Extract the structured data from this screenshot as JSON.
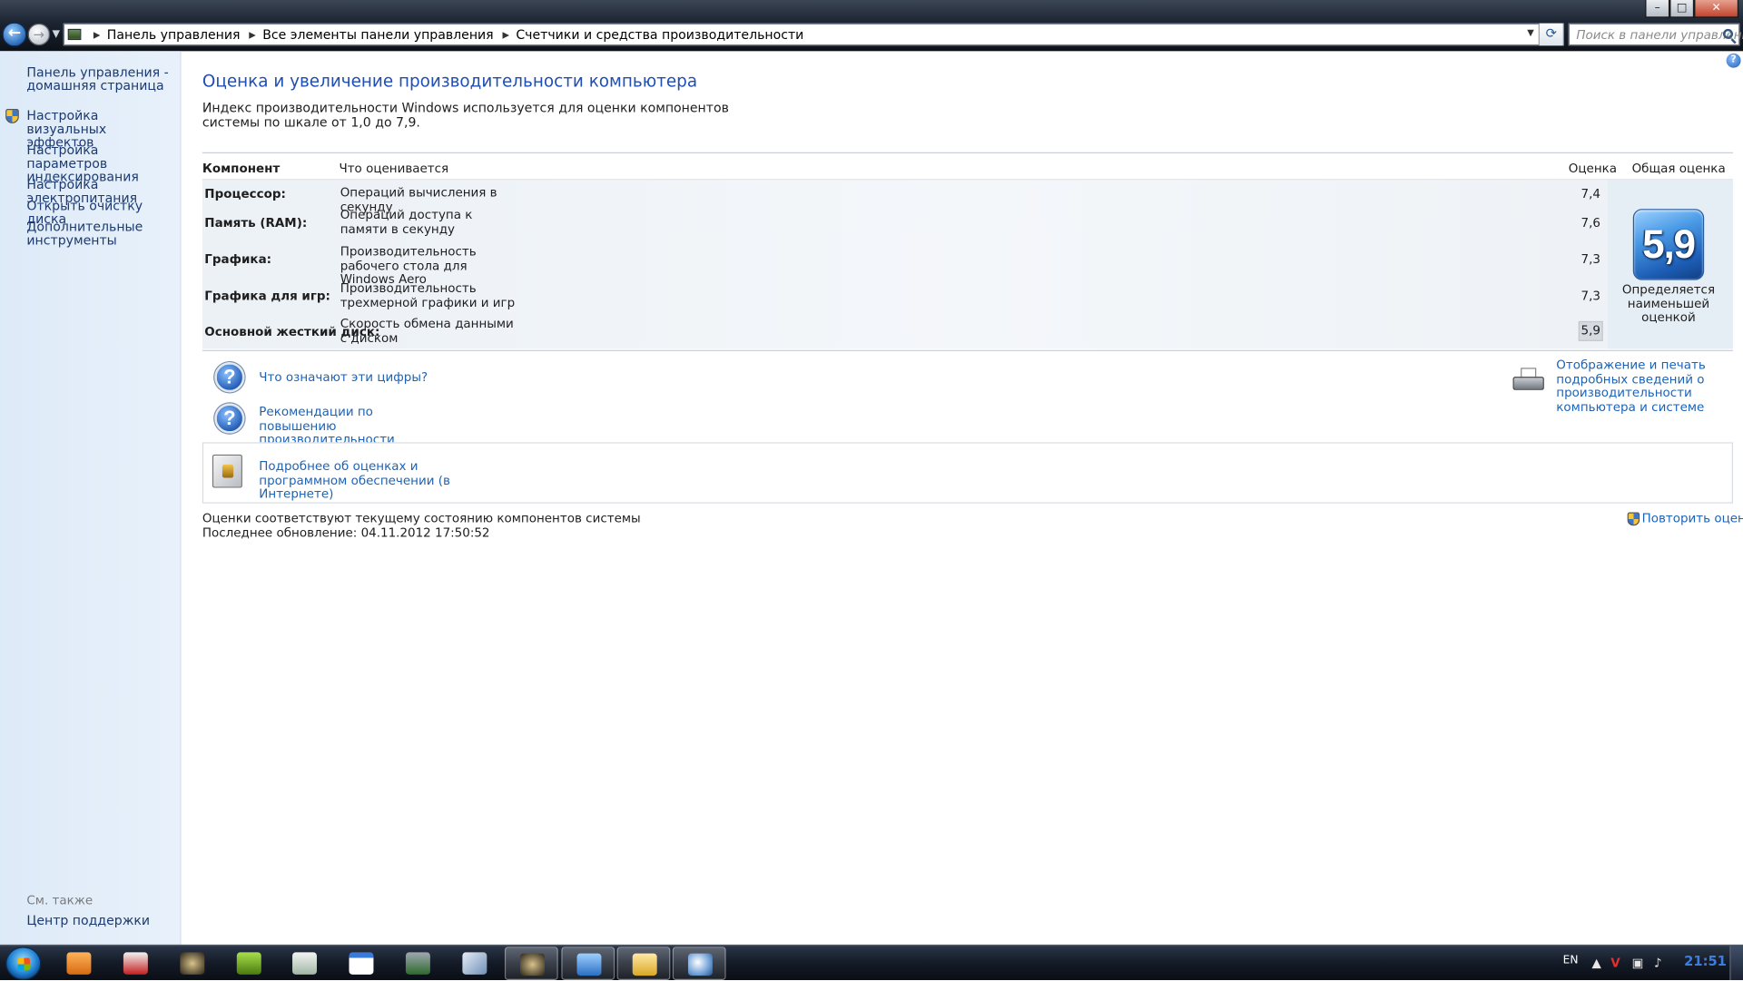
{
  "window": {
    "breadcrumbs": [
      "Панель управления",
      "Все элементы панели управления",
      "Счетчики и средства производительности"
    ],
    "search_placeholder": "Поиск в панели управления",
    "controls": {
      "minimize": "–",
      "maximize": "□",
      "close": "✕"
    }
  },
  "sidebar": {
    "items": [
      "Панель управления - домашняя страница",
      "Настройка визуальных эффектов",
      "Настройка параметров индексирования",
      "Настройка электропитания",
      "Открыть очистку диска",
      "Дополнительные инструменты"
    ],
    "see_also_label": "См. также",
    "see_also_items": [
      "Центр поддержки"
    ]
  },
  "main": {
    "title": "Оценка и увеличение производительности компьютера",
    "intro": "Индекс производительности Windows используется для оценки компонентов системы по шкале от 1,0 до 7,9.",
    "columns": {
      "component": "Компонент",
      "what": "Что оценивается",
      "score": "Оценка",
      "overall": "Общая оценка"
    },
    "rows": [
      {
        "component": "Процессор:",
        "what": "Операций вычисления в секунду",
        "score": "7,4"
      },
      {
        "component": "Память (RAM):",
        "what": "Операций доступа к памяти в секунду",
        "score": "7,6"
      },
      {
        "component": "Графика:",
        "what": "Производительность рабочего стола для Windows Aero",
        "score": "7,3"
      },
      {
        "component": "Графика для игр:",
        "what": "Производительность трехмерной графики и игр",
        "score": "7,3"
      },
      {
        "component": "Основной жесткий диск:",
        "what": "Скорость обмена данными с диском",
        "score": "5,9"
      }
    ],
    "overall_score": "5,9",
    "overall_caption": "Определяется наименьшей оценкой",
    "links": {
      "what_numbers_mean": "Что означают эти цифры?",
      "tips": "Рекомендации по повышению производительности компьютера.",
      "print_details": "Отображение и печать подробных сведений о производительности компьютера и системе",
      "online_info": "Подробнее об оценках и программном обеспечении (в Интернете)"
    },
    "status_line1": "Оценки соответствуют текущему состоянию компонентов системы",
    "status_line2": "Последнее обновление: 04.11.2012 17:50:52",
    "rerun": "Повторить оценку"
  },
  "taskbar": {
    "apps": [
      "media-player",
      "app-red",
      "app-dark-1",
      "app-me",
      "app-notes",
      "app-window",
      "app-monitor",
      "app-doc",
      "app-dark-2",
      "control-panel",
      "explorer",
      "paint"
    ],
    "active_app": "control-panel",
    "language": "EN",
    "clock": "21:51"
  },
  "colors": {
    "link": "#1b63b8",
    "title": "#1f4eb4",
    "badge": "#2a6bc7"
  }
}
